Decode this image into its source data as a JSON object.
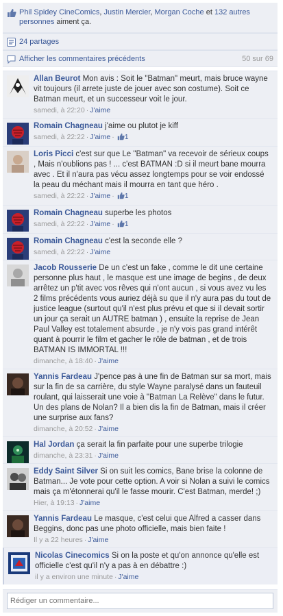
{
  "likes": {
    "names": [
      "Phil Spidey CineComics",
      "Justin Mercier",
      "Morgan Coche"
    ],
    "sep": ", ",
    "and": " et ",
    "others_link": "132 autres personnes",
    "suffix": " aiment ça."
  },
  "shares": {
    "label": "24 partages"
  },
  "previous": {
    "label": "Afficher les commentaires précédents",
    "count": "50 sur 69"
  },
  "like_action": "J'aime",
  "comments": [
    {
      "author": "Allan Beurot",
      "text": "Mon avis : Soit le \"Batman\" meurt, mais bruce wayne vit toujours (il arrete juste de jouer avec son costume). Soit ce Batman meurt, et un successeur voit le jour.",
      "time": "samedi, à 22:20",
      "likes": ""
    },
    {
      "author": "Romain Chagneau",
      "text": "j'aime ou plutot je kiff",
      "time": "samedi, à 22:22",
      "likes": "1"
    },
    {
      "author": "Loris Picci",
      "text": "c'est sur que Le \"Batman\" va recevoir de sérieux coups , Mais n'oublions pas ! ... c'est BATMAN :D si il meurt bane mourra avec . Et il n'aura pas vécu assez longtemps pour se voir endossé la peau du méchant mais il mourra en tant que héro .",
      "time": "samedi, à 22:22",
      "likes": "1"
    },
    {
      "author": "Romain Chagneau",
      "text": "superbe les photos",
      "time": "samedi, à 22:22",
      "likes": "1"
    },
    {
      "author": "Romain Chagneau",
      "text": "c'est la seconde elle ?",
      "time": "samedi, à 22:22",
      "likes": ""
    },
    {
      "author": "Jacob Rousserie",
      "text": "De un c'est un fake , comme le dit une certaine personne plus haut , le masque est une image de begins , de deux arrêtez un p'tit avec vos rêves qui n'ont aucun , si vous avez vu les 2 films précédents vous auriez déjà su que il n'y aura pas du tout de justice league (surtout qu'il n'est plus prévu et que si il devait sortir un jour ça serait un AUTRE batman ) , ensuite la reprise de Jean Paul Valley est totalement absurde , je n'y vois pas grand intérêt quant à pourrir le film et gacher le rôle de batman , et de trois BATMAN IS IMMORTAL !!!",
      "time": "dimanche, à 18:40",
      "likes": ""
    },
    {
      "author": "Yannis Fardeau",
      "text": "J'pence pas à une fin de Batman sur sa mort, mais sur la fin de sa carrière, du style Wayne paralysé dans un fauteuil roulant, qui laisserait une voie à \"Batman La Relève\" dans le futur. Un des plans de Nolan? Il a bien dis la fin de Batman, mais il créer une surprise aux fans?",
      "time": "dimanche, à 20:52",
      "likes": ""
    },
    {
      "author": "Hal Jordan",
      "text": "ça serait la fin parfaite pour une superbe trilogie",
      "time": "dimanche, à 23:31",
      "likes": ""
    },
    {
      "author": "Eddy Saint Silver",
      "text": "Si on suit les comics, Bane brise la colonne de Batman... Je vote pour cette option. A voir si Nolan a suivi le comics mais ça m'étonnerai qu'il le fasse mourir. C'est Batman, merde! ;)",
      "time": "Hier, à 19:13",
      "likes": ""
    },
    {
      "author": "Yannis Fardeau",
      "text": "Le masque, c'est celui que Alfred a casser dans Beggins, donc pas une photo officielle, mais bien faite !",
      "time": "Il y a 22 heures",
      "likes": ""
    },
    {
      "author": "Nicolas Cinecomics",
      "text": "Si on la poste et qu'on annonce qu'elle est officielle c'est qu'il n'y a pas à en débattre :)",
      "time": "il y a environ une minute",
      "likes": ""
    }
  ],
  "reply": {
    "placeholder": "Rédiger un commentaire..."
  }
}
